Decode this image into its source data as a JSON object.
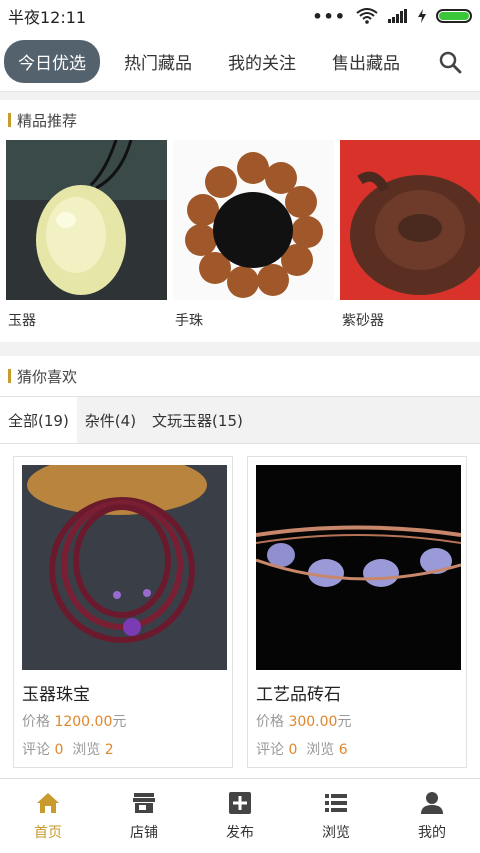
{
  "status": {
    "time": "半夜12:11"
  },
  "nav": {
    "tabs": [
      "今日优选",
      "热门藏品",
      "我的关注",
      "售出藏品"
    ]
  },
  "recommend": {
    "title": "精品推荐",
    "items": [
      {
        "label": "玉器"
      },
      {
        "label": "手珠"
      },
      {
        "label": "紫砂器"
      }
    ]
  },
  "guess": {
    "title": "猜你喜欢",
    "filters": [
      "全部(19)",
      "杂件(4)",
      "文玩玉器(15)"
    ]
  },
  "products": [
    {
      "title": "玉器珠宝",
      "price_label": "价格",
      "price": "1200.00",
      "unit": "元",
      "comment_label": "评论",
      "comments": "0",
      "view_label": "浏览",
      "views": "2"
    },
    {
      "title": "工艺品砖石",
      "price_label": "价格",
      "price": "300.00",
      "unit": "元",
      "comment_label": "评论",
      "comments": "0",
      "view_label": "浏览",
      "views": "6"
    }
  ],
  "bottom_nav": [
    "首页",
    "店铺",
    "发布",
    "浏览",
    "我的"
  ],
  "colors": {
    "accent": "#c99a2e",
    "price": "#e0862b",
    "active_tab": "#54626e"
  }
}
